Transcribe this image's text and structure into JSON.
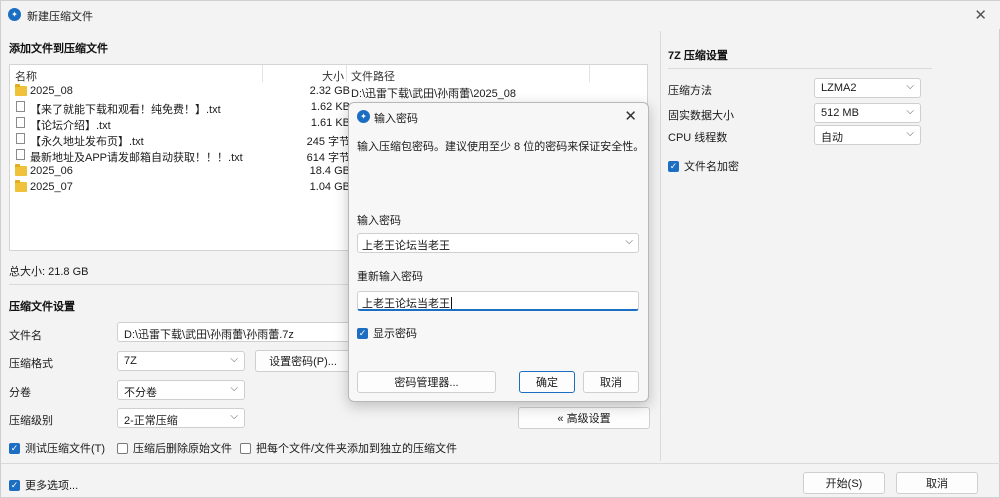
{
  "window": {
    "title": "新建压缩文件"
  },
  "files_section": {
    "heading": "添加文件到压缩文件",
    "columns": {
      "name": "名称",
      "size": "大小",
      "path": "文件路径"
    },
    "rows": [
      {
        "name": "2025_08",
        "size": "2.32 GB",
        "path": "D:\\迅雷下载\\武田\\孙雨蕾\\2025_08",
        "icon": "folder"
      },
      {
        "name": "【来了就能下载和观看！纯免费！】.txt",
        "size": "1.62 KB",
        "path": "",
        "icon": "text-file"
      },
      {
        "name": "【论坛介绍】.txt",
        "size": "1.61 KB",
        "path": "",
        "icon": "text-file"
      },
      {
        "name": "【永久地址发布页】.txt",
        "size": "245 字节",
        "path": "",
        "icon": "text-file"
      },
      {
        "name": "最新地址及APP请发邮箱自动获取！！！.txt",
        "size": "614 字节",
        "path": "",
        "icon": "text-file"
      },
      {
        "name": "2025_06",
        "size": "18.4 GB",
        "path": "",
        "icon": "folder"
      },
      {
        "name": "2025_07",
        "size": "1.04 GB",
        "path": "",
        "icon": "folder"
      }
    ],
    "total_size": "总大小: 21.8 GB"
  },
  "archive_settings": {
    "heading": "压缩文件设置",
    "filename_label": "文件名",
    "filename_value": "D:\\迅雷下载\\武田\\孙雨蕾\\孙雨蕾.7z",
    "format_label": "压缩格式",
    "format_value": "7Z",
    "split_label": "分卷",
    "split_value": "不分卷",
    "level_label": "压缩级别",
    "level_value": "2-正常压缩",
    "set_password_button": "设置密码(P)...",
    "advanced_button": "« 高级设置",
    "test_archive": "测试压缩文件(T)",
    "delete_after": "压缩后删除原始文件",
    "separate_archives": "把每个文件/文件夹添加到独立的压缩文件"
  },
  "sevenzip_settings": {
    "heading": "7Z 压缩设置",
    "method_label": "压缩方法",
    "method_value": "LZMA2",
    "dict_label": "固实数据大小",
    "dict_value": "512 MB",
    "threads_label": "CPU 线程数",
    "threads_value": "自动",
    "encrypt_names": "文件名加密"
  },
  "footer": {
    "more_options": "更多选项...",
    "start_button": "开始(S)",
    "cancel_button": "取消"
  },
  "password_dialog": {
    "title": "输入密码",
    "message": "输入压缩包密码。建议使用至少 8 位的密码来保证安全性。",
    "password_label": "输入密码",
    "password_value": "上老王论坛当老王",
    "confirm_label": "重新输入密码",
    "confirm_value": "上老王论坛当老王",
    "show_password": "显示密码",
    "manager_button": "密码管理器...",
    "ok_button": "确定",
    "cancel_button": "取消"
  },
  "colors": {
    "accent": "#1b6ec2",
    "folder": "#f0c23a"
  }
}
